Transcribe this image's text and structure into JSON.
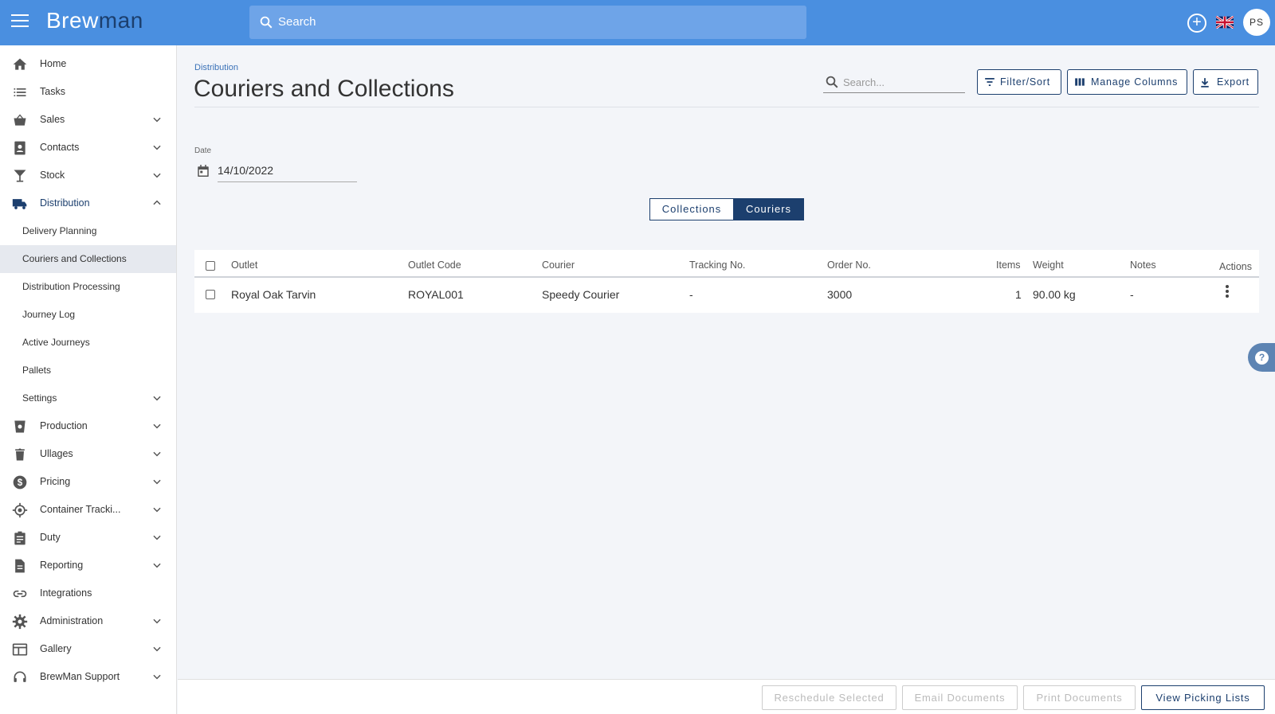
{
  "app": {
    "logo_prefix": "Brew",
    "logo_suffix": "man",
    "search_placeholder": "Search",
    "user_initials": "PS",
    "colors": {
      "topbar": "#4a8fe0",
      "navy": "#1c3f6e",
      "link": "#3b72b8"
    }
  },
  "sidebar": {
    "items": [
      {
        "label": "Home",
        "icon": "home-icon",
        "expandable": false
      },
      {
        "label": "Tasks",
        "icon": "list-icon",
        "expandable": false
      },
      {
        "label": "Sales",
        "icon": "basket-icon",
        "expandable": true
      },
      {
        "label": "Contacts",
        "icon": "contacts-icon",
        "expandable": true
      },
      {
        "label": "Stock",
        "icon": "glass-icon",
        "expandable": true
      },
      {
        "label": "Distribution",
        "icon": "truck-icon",
        "expandable": true,
        "expanded": true
      },
      {
        "label": "Production",
        "icon": "beaker-icon",
        "expandable": true
      },
      {
        "label": "Ullages",
        "icon": "trash-icon",
        "expandable": true
      },
      {
        "label": "Pricing",
        "icon": "dollar-icon",
        "expandable": true
      },
      {
        "label": "Container Tracki...",
        "icon": "target-icon",
        "expandable": true
      },
      {
        "label": "Duty",
        "icon": "clipboard-icon",
        "expandable": true
      },
      {
        "label": "Reporting",
        "icon": "document-icon",
        "expandable": true
      },
      {
        "label": "Integrations",
        "icon": "link-icon",
        "expandable": false
      },
      {
        "label": "Administration",
        "icon": "gear-icon",
        "expandable": true
      },
      {
        "label": "Gallery",
        "icon": "gallery-icon",
        "expandable": true
      },
      {
        "label": "BrewMan Support",
        "icon": "headset-icon",
        "expandable": true
      }
    ],
    "distribution_sub": [
      {
        "label": "Delivery Planning"
      },
      {
        "label": "Couriers and Collections",
        "active": true
      },
      {
        "label": "Distribution Processing"
      },
      {
        "label": "Journey Log"
      },
      {
        "label": "Active Journeys"
      },
      {
        "label": "Pallets"
      },
      {
        "label": "Settings",
        "expandable": true
      }
    ]
  },
  "page": {
    "breadcrumb": "Distribution",
    "title": "Couriers and Collections",
    "search_placeholder": "Search...",
    "buttons": {
      "filter": "Filter/Sort",
      "columns": "Manage Columns",
      "export": "Export"
    },
    "date_label": "Date",
    "date_value": "14/10/2022",
    "toggle": {
      "collections": "Collections",
      "couriers": "Couriers",
      "selected": "Couriers"
    }
  },
  "table": {
    "headers": {
      "outlet": "Outlet",
      "outlet_code": "Outlet Code",
      "courier": "Courier",
      "tracking": "Tracking No.",
      "order": "Order No.",
      "items": "Items",
      "weight": "Weight",
      "notes": "Notes",
      "actions": "Actions"
    },
    "rows": [
      {
        "outlet": "Royal Oak Tarvin",
        "outlet_code": "ROYAL001",
        "courier": "Speedy Courier",
        "tracking": "-",
        "order": "3000",
        "items": "1",
        "weight": "90.00 kg",
        "notes": "-"
      }
    ]
  },
  "footer": {
    "reschedule": "Reschedule Selected",
    "email": "Email Documents",
    "print": "Print Documents",
    "picking": "View Picking Lists"
  }
}
